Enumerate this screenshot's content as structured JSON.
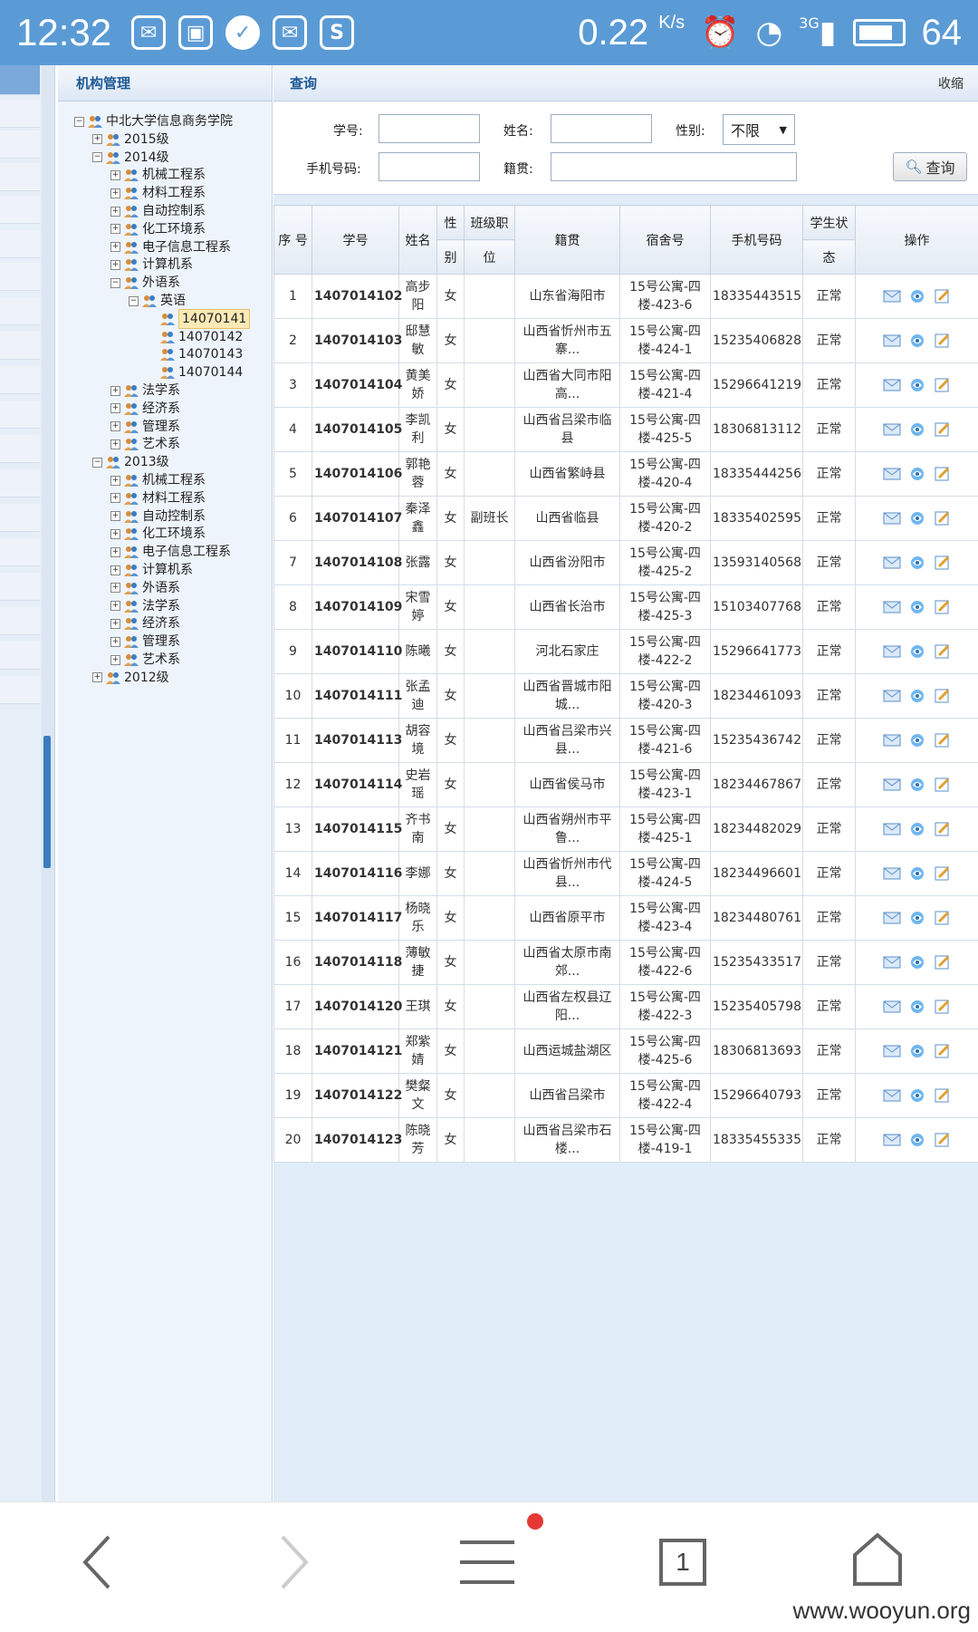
{
  "status_bar": {
    "time": "12:32",
    "speed": "0.22",
    "speed_unit": "K/s",
    "signal_label": "3G",
    "battery": "64"
  },
  "tree": {
    "title": "机构管理",
    "root": "中北大学信息商务学院",
    "years": [
      {
        "label": "2015级",
        "expanded": false
      },
      {
        "label": "2014级",
        "expanded": true,
        "depts": [
          "机械工程系",
          "材料工程系",
          "自动控制系",
          "化工环境系",
          "电子信息工程系",
          "计算机系",
          "外语系",
          "法学系",
          "经济系",
          "管理系",
          "艺术系"
        ],
        "open_dept": "外语系",
        "sub": "英语",
        "classes": [
          "14070141",
          "14070142",
          "14070143",
          "14070144"
        ],
        "selected": "14070141"
      },
      {
        "label": "2013级",
        "expanded": true,
        "depts": [
          "机械工程系",
          "材料工程系",
          "自动控制系",
          "化工环境系",
          "电子信息工程系",
          "计算机系",
          "外语系",
          "法学系",
          "经济系",
          "管理系",
          "艺术系"
        ]
      },
      {
        "label": "2012级",
        "expanded": false
      }
    ]
  },
  "query": {
    "title": "查询",
    "collapse": "收缩",
    "student_id_label": "学号:",
    "name_label": "姓名:",
    "gender_label": "性别:",
    "gender_value": "不限",
    "phone_label": "手机号码:",
    "origin_label": "籍贯:",
    "search_button": "查询"
  },
  "table": {
    "headers": {
      "seq": "序 号",
      "student_id": "学号",
      "name": "姓名",
      "gender_top": "性",
      "gender_bottom": "别",
      "position_top": "班级职",
      "position_bottom": "位",
      "origin": "籍贯",
      "dorm": "宿舍号",
      "phone": "手机号码",
      "status_top": "学生状",
      "status_bottom": "态",
      "ops": "操作"
    },
    "rows": [
      {
        "seq": "1",
        "id": "1407014102",
        "name": "高步阳",
        "gender": "女",
        "pos": "",
        "origin": "山东省海阳市",
        "dorm": "15号公寓-四楼-423-6",
        "phone": "18335443515",
        "status": "正常"
      },
      {
        "seq": "2",
        "id": "1407014103",
        "name": "邸慧敏",
        "gender": "女",
        "pos": "",
        "origin": "山西省忻州市五寨...",
        "dorm": "15号公寓-四楼-424-1",
        "phone": "15235406828",
        "status": "正常"
      },
      {
        "seq": "3",
        "id": "1407014104",
        "name": "黄美娇",
        "gender": "女",
        "pos": "",
        "origin": "山西省大同市阳高...",
        "dorm": "15号公寓-四楼-421-4",
        "phone": "15296641219",
        "status": "正常"
      },
      {
        "seq": "4",
        "id": "1407014105",
        "name": "李凯利",
        "gender": "女",
        "pos": "",
        "origin": "山西省吕梁市临县",
        "dorm": "15号公寓-四楼-425-5",
        "phone": "18306813112",
        "status": "正常"
      },
      {
        "seq": "5",
        "id": "1407014106",
        "name": "郭艳蓉",
        "gender": "女",
        "pos": "",
        "origin": "山西省繁峙县",
        "dorm": "15号公寓-四楼-420-4",
        "phone": "18335444256",
        "status": "正常"
      },
      {
        "seq": "6",
        "id": "1407014107",
        "name": "秦泽鑫",
        "gender": "女",
        "pos": "副班长",
        "origin": "山西省临县",
        "dorm": "15号公寓-四楼-420-2",
        "phone": "18335402595",
        "status": "正常"
      },
      {
        "seq": "7",
        "id": "1407014108",
        "name": "张露",
        "gender": "女",
        "pos": "",
        "origin": "山西省汾阳市",
        "dorm": "15号公寓-四楼-425-2",
        "phone": "13593140568",
        "status": "正常"
      },
      {
        "seq": "8",
        "id": "1407014109",
        "name": "宋雪婷",
        "gender": "女",
        "pos": "",
        "origin": "山西省长治市",
        "dorm": "15号公寓-四楼-425-3",
        "phone": "15103407768",
        "status": "正常"
      },
      {
        "seq": "9",
        "id": "1407014110",
        "name": "陈曦",
        "gender": "女",
        "pos": "",
        "origin": "河北石家庄",
        "dorm": "15号公寓-四楼-422-2",
        "phone": "15296641773",
        "status": "正常"
      },
      {
        "seq": "10",
        "id": "1407014111",
        "name": "张孟迪",
        "gender": "女",
        "pos": "",
        "origin": "山西省晋城市阳城...",
        "dorm": "15号公寓-四楼-420-3",
        "phone": "18234461093",
        "status": "正常"
      },
      {
        "seq": "11",
        "id": "1407014113",
        "name": "胡容境",
        "gender": "女",
        "pos": "",
        "origin": "山西省吕梁市兴县...",
        "dorm": "15号公寓-四楼-421-6",
        "phone": "15235436742",
        "status": "正常"
      },
      {
        "seq": "12",
        "id": "1407014114",
        "name": "史岩瑶",
        "gender": "女",
        "pos": "",
        "origin": "山西省侯马市",
        "dorm": "15号公寓-四楼-423-1",
        "phone": "18234467867",
        "status": "正常"
      },
      {
        "seq": "13",
        "id": "1407014115",
        "name": "齐书南",
        "gender": "女",
        "pos": "",
        "origin": "山西省朔州市平鲁...",
        "dorm": "15号公寓-四楼-425-1",
        "phone": "18234482029",
        "status": "正常"
      },
      {
        "seq": "14",
        "id": "1407014116",
        "name": "李娜",
        "gender": "女",
        "pos": "",
        "origin": "山西省忻州市代县...",
        "dorm": "15号公寓-四楼-424-5",
        "phone": "18234496601",
        "status": "正常"
      },
      {
        "seq": "15",
        "id": "1407014117",
        "name": "杨晓乐",
        "gender": "女",
        "pos": "",
        "origin": "山西省原平市",
        "dorm": "15号公寓-四楼-423-4",
        "phone": "18234480761",
        "status": "正常"
      },
      {
        "seq": "16",
        "id": "1407014118",
        "name": "薄敏捷",
        "gender": "女",
        "pos": "",
        "origin": "山西省太原市南郊...",
        "dorm": "15号公寓-四楼-422-6",
        "phone": "15235433517",
        "status": "正常"
      },
      {
        "seq": "17",
        "id": "1407014120",
        "name": "王琪",
        "gender": "女",
        "pos": "",
        "origin": "山西省左权县辽阳...",
        "dorm": "15号公寓-四楼-422-3",
        "phone": "15235405798",
        "status": "正常"
      },
      {
        "seq": "18",
        "id": "1407014121",
        "name": "郑紫婧",
        "gender": "女",
        "pos": "",
        "origin": "山西运城盐湖区",
        "dorm": "15号公寓-四楼-425-6",
        "phone": "18306813693",
        "status": "正常"
      },
      {
        "seq": "19",
        "id": "1407014122",
        "name": "樊粲文",
        "gender": "女",
        "pos": "",
        "origin": "山西省吕梁市",
        "dorm": "15号公寓-四楼-422-4",
        "phone": "15296640793",
        "status": "正常"
      },
      {
        "seq": "20",
        "id": "1407014123",
        "name": "陈晓芳",
        "gender": "女",
        "pos": "",
        "origin": "山西省吕梁市石楼...",
        "dorm": "15号公寓-四楼-419-1",
        "phone": "18335455335",
        "status": "正常"
      }
    ]
  },
  "nav": {
    "back_icon": "chevron-left-icon",
    "forward_icon": "chevron-right-icon",
    "menu_icon": "menu-icon",
    "tabs_count": "1",
    "home_icon": "home-icon"
  },
  "watermark": "www.wooyun.org",
  "colors": {
    "status_bar": "#5b9bd5",
    "link_blue": "#1a5fa8",
    "panel_bg": "#e1edf9",
    "notification_dot": "#e53935"
  }
}
